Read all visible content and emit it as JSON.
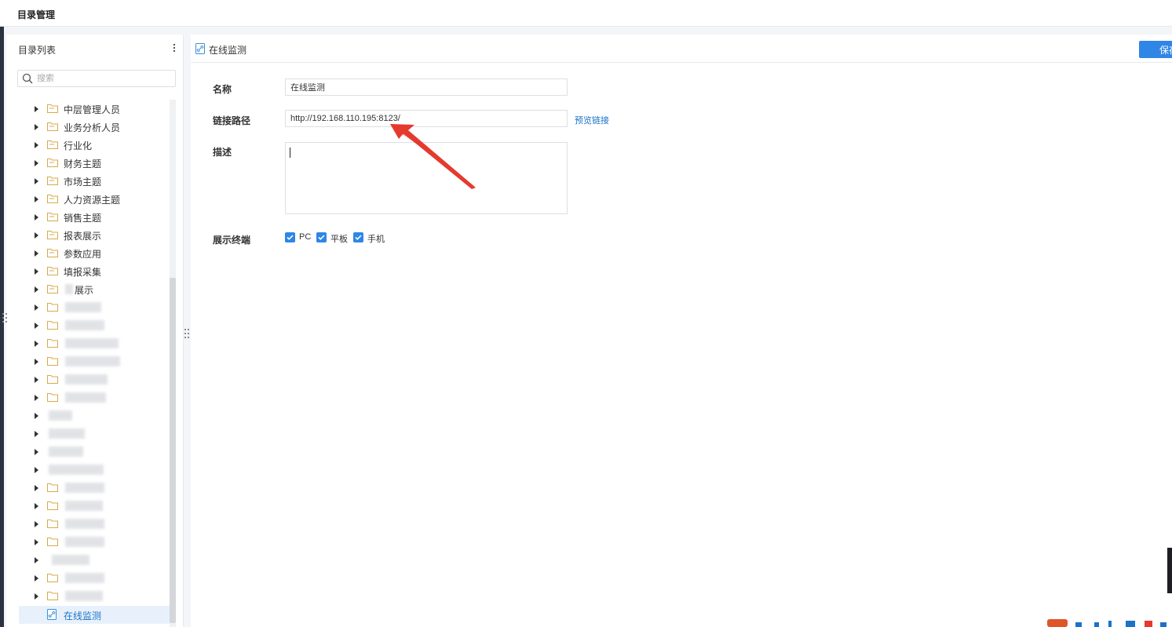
{
  "header": {
    "title": "目录管理"
  },
  "left_panel": {
    "title": "目录列表",
    "search_placeholder": "搜索",
    "tree": [
      {
        "label": "中层管理人员"
      },
      {
        "label": "业务分析人员"
      },
      {
        "label": "行业化"
      },
      {
        "label": "财务主题"
      },
      {
        "label": "市场主题"
      },
      {
        "label": "人力资源主题"
      },
      {
        "label": "销售主题"
      },
      {
        "label": "报表展示"
      },
      {
        "label": "参数应用"
      },
      {
        "label": "填报采集"
      },
      {
        "label": "展示"
      }
    ],
    "selected_item": {
      "label": "在线监测"
    }
  },
  "main": {
    "breadcrumb": "在线监测",
    "save_label": "保存",
    "form": {
      "name_label": "名称",
      "name_value": "在线监测",
      "path_label": "链接路径",
      "path_value": "http://192.168.110.195:8123/",
      "preview_link": "预览链接",
      "desc_label": "描述",
      "desc_value": "",
      "terminal_label": "展示终端",
      "terminals": [
        {
          "label": "PC",
          "checked": true
        },
        {
          "label": "平板",
          "checked": true
        },
        {
          "label": "手机",
          "checked": true
        }
      ]
    }
  },
  "colors": {
    "accent": "#2f86e6",
    "link": "#1a73c9",
    "annotation_arrow": "#e53a2e"
  }
}
